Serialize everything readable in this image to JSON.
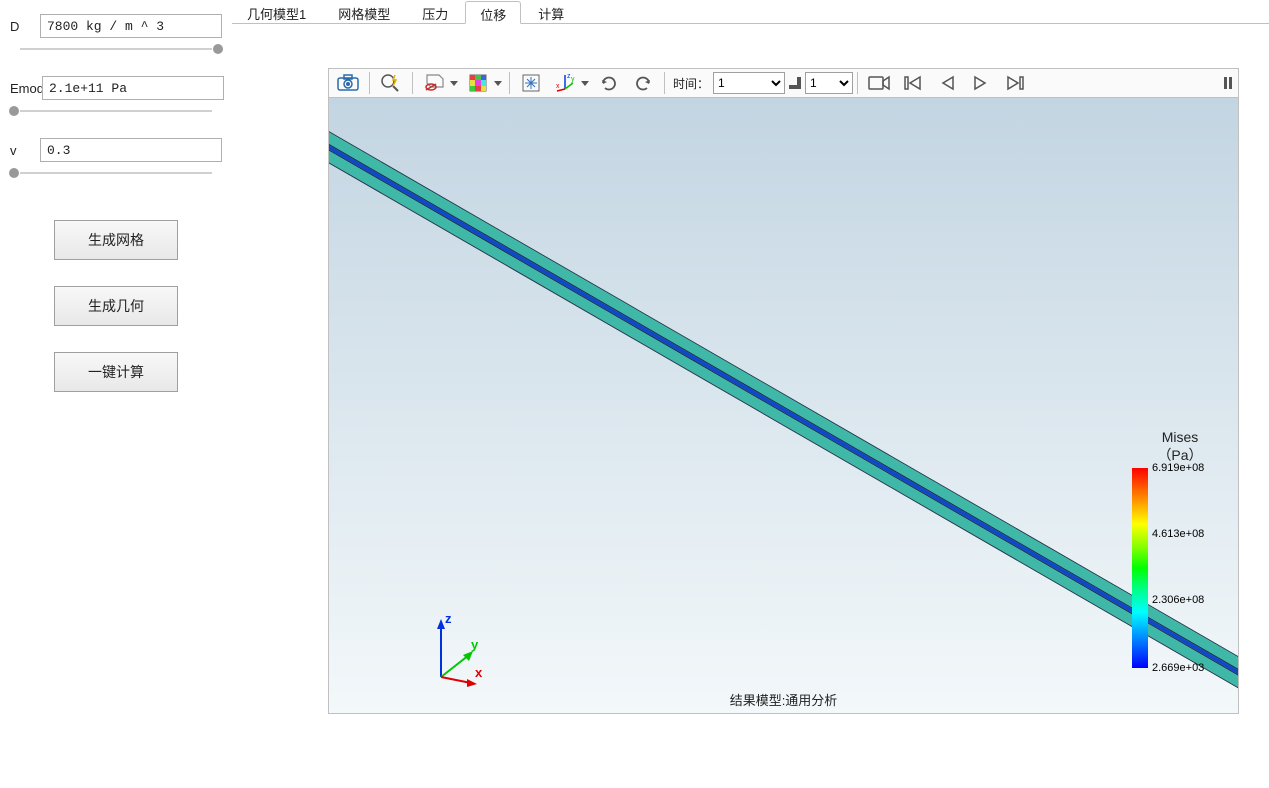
{
  "sidebar": {
    "params": {
      "D": {
        "label": "D",
        "value": "7800 kg / m ^ 3",
        "slider_pos": "98%"
      },
      "Emod": {
        "label": "Emod",
        "value": "2.1e+11 Pa",
        "slider_pos": "2%"
      },
      "v": {
        "label": "v",
        "value": "0.3",
        "slider_pos": "2%"
      }
    },
    "buttons": {
      "mesh": "生成网格",
      "geom": "生成几何",
      "calc": "一键计算"
    }
  },
  "tabs": {
    "geom": "几何模型1",
    "mesh": "网格模型",
    "pressure": "压力",
    "disp": "位移",
    "calc": "计算",
    "active": "disp"
  },
  "toolbar": {
    "time_label": "时间：",
    "time_value": "1",
    "frame_value": "1"
  },
  "viewport": {
    "bottom_label": "结果模型:通用分析",
    "axes": {
      "x": "x",
      "y": "y",
      "z": "z"
    }
  },
  "legend": {
    "title_line1": "Mises",
    "title_line2": "（Pa）",
    "ticks": [
      {
        "value": "6.919e+08",
        "pos": "0%"
      },
      {
        "value": "4.613e+08",
        "pos": "33%"
      },
      {
        "value": "2.306e+08",
        "pos": "66%"
      },
      {
        "value": "2.669e+03",
        "pos": "100%"
      }
    ]
  }
}
